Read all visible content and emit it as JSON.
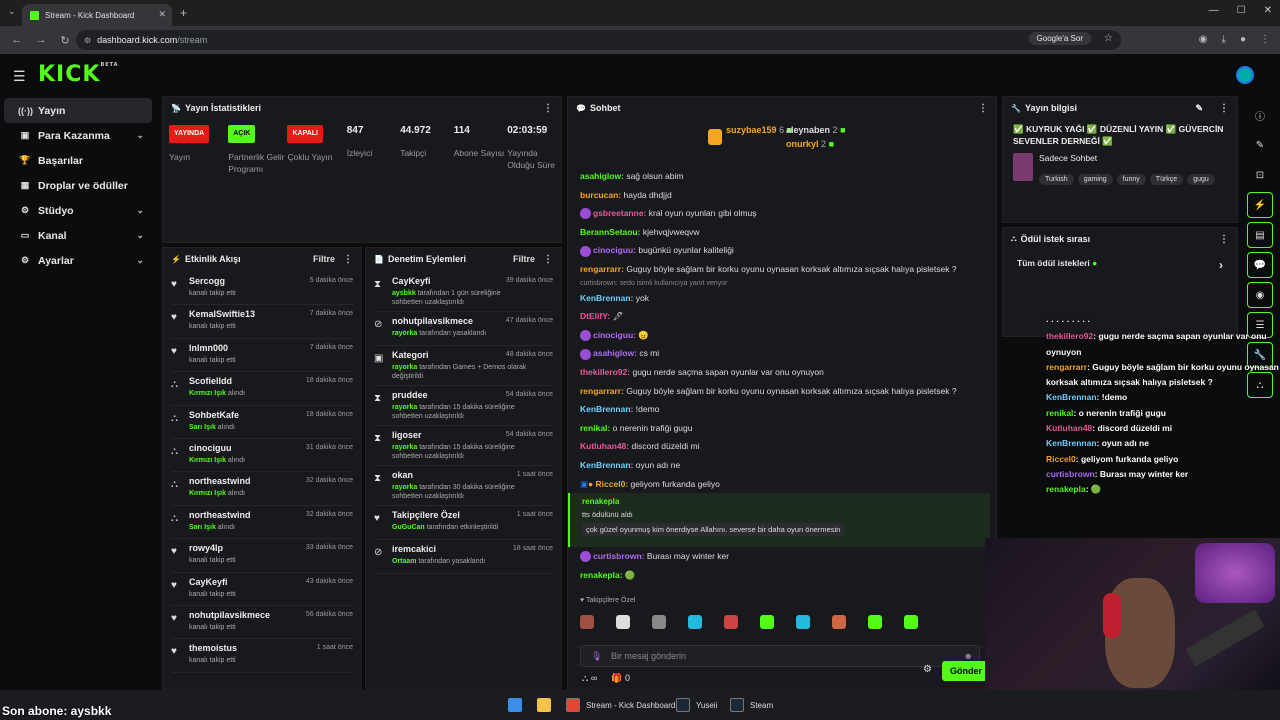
{
  "browser": {
    "tab_title": "Stream - Kick Dashboard",
    "url_host": "dashboard.kick.com",
    "url_path": "/stream",
    "google_btn": "Google'a Sor"
  },
  "header": {
    "logo": "KICK",
    "logo_sup": "BETA"
  },
  "sidebar": {
    "items": [
      {
        "label": "Yayın",
        "icon": "broadcast-icon",
        "active": true,
        "chev": false
      },
      {
        "label": "Para Kazanma",
        "icon": "money-icon",
        "chev": true
      },
      {
        "label": "Başarılar",
        "icon": "trophy-icon",
        "chev": false
      },
      {
        "label": "Droplar ve ödüller",
        "icon": "gift-icon",
        "chev": false
      },
      {
        "label": "Stüdyo",
        "icon": "gear-icon",
        "chev": true
      },
      {
        "label": "Kanal",
        "icon": "channel-icon",
        "chev": true
      },
      {
        "label": "Ayarlar",
        "icon": "settings-icon",
        "chev": true
      }
    ]
  },
  "stats": {
    "title": "Yayın İstatistikleri",
    "items": [
      {
        "badge": "YAYINDA",
        "color": "red",
        "label": "Yayın"
      },
      {
        "badge": "AÇIK",
        "color": "green",
        "label": "Partnerlik Gelir Programı"
      },
      {
        "badge": "KAPALI",
        "color": "red",
        "label": "Çoklu Yayın"
      },
      {
        "value": "847",
        "label": "İzleyici"
      },
      {
        "value": "44.972",
        "label": "Takipçi"
      },
      {
        "value": "114",
        "label": "Abone Sayısı"
      },
      {
        "value": "02:03:59",
        "label": "Yayında Olduğu Süre"
      }
    ]
  },
  "activity": {
    "title": "Etkinlik Akışı",
    "filter": "Filtre",
    "items": [
      {
        "name": "Sercogg",
        "sub": "kanalı takip etti",
        "time": "5 dakika önce",
        "icon": "heart-icon"
      },
      {
        "name": "KemalSwiftie13",
        "sub": "kanalı takip etti",
        "time": "7 dakika önce",
        "icon": "heart-icon"
      },
      {
        "name": "lnlmn000",
        "sub": "kanalı takip etti",
        "time": "7 dakika önce",
        "icon": "heart-icon"
      },
      {
        "name": "Scofielldd",
        "hl": "Kırmızı Işık",
        "sub": " alındı",
        "time": "18 dakika önce",
        "icon": "reward-icon"
      },
      {
        "name": "SohbetKafe",
        "hl": "Sarı Işık",
        "sub": " alındı",
        "time": "18 dakika önce",
        "icon": "reward-icon"
      },
      {
        "name": "cinociguu",
        "hl": "Kırmızı Işık",
        "sub": " alındı",
        "time": "31 dakika önce",
        "icon": "reward-icon"
      },
      {
        "name": "northeastwind",
        "hl": "Kırmızı Işık",
        "sub": " alındı",
        "time": "32 dakika önce",
        "icon": "reward-icon"
      },
      {
        "name": "northeastwind",
        "hl": "Sarı Işık",
        "sub": " alındı",
        "time": "32 dakika önce",
        "icon": "reward-icon"
      },
      {
        "name": "rowy4lp",
        "sub": "kanalı takip etti",
        "time": "33 dakika önce",
        "icon": "heart-icon"
      },
      {
        "name": "CayKeyfi",
        "sub": "kanalı takip etti",
        "time": "43 dakika önce",
        "icon": "heart-icon"
      },
      {
        "name": "nohutpilavsikmece",
        "sub": "kanalı takip etti",
        "time": "56 dakika önce",
        "icon": "heart-icon"
      },
      {
        "name": "themoistus",
        "sub": "kanalı takip etti",
        "time": "1 saat önce",
        "icon": "heart-icon"
      }
    ]
  },
  "mod": {
    "title": "Denetim Eylemleri",
    "filter": "Filtre",
    "items": [
      {
        "name": "CayKeyfi",
        "time": "39 dakika önce",
        "actor": "aysbkk",
        "sub": " tarafından 1 gün süreliğine sohbetten uzaklaştırıldı",
        "icon": "hourglass-icon"
      },
      {
        "name": "nohutpilavsikmece",
        "time": "47 dakika önce",
        "actor": "rayorka",
        "sub": " tarafından yasaklandı",
        "icon": "ban-icon"
      },
      {
        "name": "Kategori",
        "time": "48 dakika önce",
        "actor": "rayorka",
        "sub": " tarafından Games + Demos olarak değiştirildi",
        "icon": "category-icon"
      },
      {
        "name": "pruddee",
        "time": "54 dakika önce",
        "actor": "rayorka",
        "sub": " tarafından 15 dakika süreliğine sohbetten uzaklaştırıldı",
        "icon": "hourglass-icon"
      },
      {
        "name": "ligoser",
        "time": "54 dakika önce",
        "actor": "rayorka",
        "sub": " tarafından 15 dakika süreliğine sohbetten uzaklaştırıldı",
        "icon": "hourglass-icon"
      },
      {
        "name": "okan",
        "time": "1 saat önce",
        "actor": "rayorka",
        "sub": " tarafından 30 dakika süreliğine sohbetten uzaklaştırıldı",
        "icon": "hourglass-icon"
      },
      {
        "name": "Takipçilere Özel",
        "time": "1 saat önce",
        "actor": "GuGuCan",
        "sub": " tarafından etkinleştirildi",
        "icon": "heart-icon"
      },
      {
        "name": "iremcakici",
        "time": "18 saat önce",
        "actor": "Ortaam",
        "sub": " tarafından yasaklandı",
        "icon": "ban-icon"
      }
    ]
  },
  "chat": {
    "title": "Sohbet",
    "top": [
      {
        "name": "suzybae159",
        "count": "6"
      },
      {
        "name": "aleynaben",
        "count": "2"
      },
      {
        "name": "onurkyl",
        "count": "2"
      }
    ],
    "messages": [
      {
        "user": "asahiglow",
        "color": "#53fc18",
        "text": "sağ olsun abim"
      },
      {
        "user": "burcucan",
        "color": "#f5a623",
        "text": "hayda dhdjjd"
      },
      {
        "user": "gsbreetanne",
        "color": "#e85a9a",
        "text": "kral oyun oyunları gibi olmuş",
        "ava": "#9b4dd6"
      },
      {
        "user": "BerannSetaou",
        "color": "#53fc18",
        "text": "kjehvqjvweqvw"
      },
      {
        "user": "cinociguu",
        "color": "#b16cf5",
        "text": "bugünkü oyunlar kaliteliği",
        "ava": "#9b4dd6"
      },
      {
        "user": "rengarrarr",
        "color": "#f5a623",
        "text": "Guguy böyle sağlam bir korku oyunu oynasan korksak altımıza sıçsak halıya pisletsek ?"
      },
      {
        "reply": "curtisbrown: sedo isimli kullanıcıya yanıt veriyor"
      },
      {
        "user": "KenBrennan",
        "color": "#6fd0ff",
        "text": "yok"
      },
      {
        "user": "DtElifY",
        "color": "#e85a9a",
        "text": "🖋"
      },
      {
        "user": "cinociguu",
        "color": "#b16cf5",
        "text": "😠",
        "ava": "#9b4dd6"
      },
      {
        "user": "asahiglow",
        "color": "#b16cf5",
        "text": "cs mi",
        "ava": "#9b4dd6"
      },
      {
        "user": "thekillero92",
        "color": "#e85a9a",
        "text": "gugu nerde saçma sapan oyunlar var onu oynuyon"
      },
      {
        "user": "rengarrarr",
        "color": "#f5a623",
        "text": "Guguy böyle sağlam bir korku oyunu oynasan korksak altımıza sıçsak halıya pisletsek ?"
      },
      {
        "user": "KenBrennan",
        "color": "#6fd0ff",
        "text": "!demo"
      },
      {
        "user": "renikal",
        "color": "#53fc18",
        "text": "o nerenin trafiği gugu"
      },
      {
        "user": "Kutluhan48",
        "color": "#e85a9a",
        "text": "discord düzeldi mi"
      },
      {
        "user": "KenBrennan",
        "color": "#6fd0ff",
        "text": "oyun adı ne"
      },
      {
        "user": "Riccel0",
        "color": "#f5a623",
        "text": "geliyom furkanda geliyo",
        "badges": true
      }
    ],
    "highlight": {
      "user": "renakepla",
      "line1": "tts ödülünü aldı",
      "line2": "çok güzel oyunmuş kim önerdiyse Allahını. severse bir daha oyun önermesin"
    },
    "after": [
      {
        "user": "curtisbrown",
        "color": "#b16cf5",
        "text": "Burası may winter ker",
        "ava": "#9b4dd6"
      },
      {
        "user": "renakepla",
        "color": "#53fc18",
        "text": "🟢"
      }
    ],
    "followers_only": "Takipçilere Özel",
    "placeholder": "Bir mesaj gönderin",
    "send": "Gönder",
    "bottom_count": "0",
    "infinity": "∞"
  },
  "stream_info": {
    "title": "Yayın bilgisi",
    "stream_title": "✅ KUYRUK YAĞI ✅ DÜZENLİ YAYIN ✅ GÜVERCİN SEVENLER DERNEĞİ ✅",
    "category": "Sadece Sohbet",
    "tags": [
      "Turkish",
      "gaming",
      "funny",
      "Türkçe",
      "gugu"
    ]
  },
  "rewards": {
    "title": "Ödül istek sırası",
    "all": "Tüm ödül istekleri"
  },
  "overlay": {
    "lines": [
      {
        "u": "",
        "t": "· · · · · · · · ·"
      },
      {
        "u": "thekillero92",
        "t": ": gugu nerde saçma sapan oyunlar var onu oynuyon",
        "c": "#e85a9a"
      },
      {
        "u": "rengarrarr",
        "t": ": Guguy böyle sağlam bir korku oyunu oynasan korksak altımıza sıçsak halıya pisletsek ?",
        "c": "#f5a623"
      },
      {
        "u": "KenBrennan",
        "t": ": !demo",
        "c": "#6fd0ff"
      },
      {
        "u": "renikal",
        "t": ": o nerenin trafiği gugu",
        "c": "#53fc18"
      },
      {
        "u": "Kutluhan48",
        "t": ": discord düzeldi mi",
        "c": "#e85a9a"
      },
      {
        "u": "KenBrennan",
        "t": ": oyun adı ne",
        "c": "#6fd0ff"
      },
      {
        "u": "Riccel0",
        "t": ": geliyom furkanda geliyo",
        "c": "#f5a623"
      },
      {
        "u": "curtisbrown",
        "t": ": Burası may winter ker",
        "c": "#b16cf5"
      },
      {
        "u": "renakepla",
        "t": ": 🟢",
        "c": "#53fc18"
      }
    ]
  },
  "sub_banner": "Son abone: aysbkk",
  "taskbar": [
    {
      "label": "Stream - Kick Dashboard"
    },
    {
      "label": "Yuseii"
    },
    {
      "label": "Steam"
    }
  ]
}
